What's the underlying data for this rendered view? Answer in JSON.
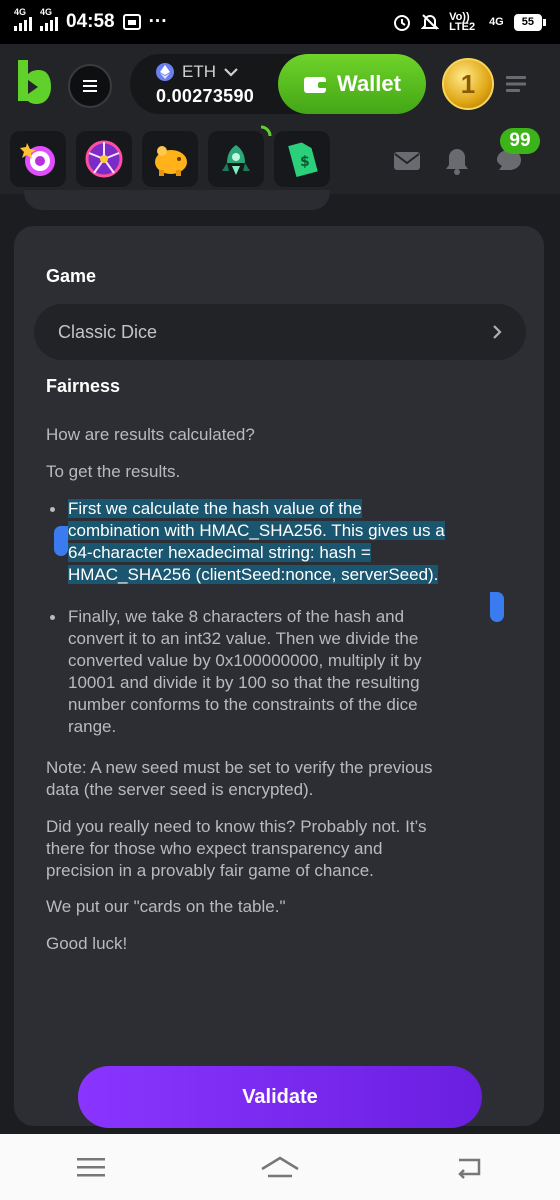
{
  "status_bar": {
    "time": "04:58",
    "net1": "4G",
    "net2": "4G",
    "volte": "Vo)) LTE2",
    "net3": "4G",
    "battery": "55"
  },
  "header": {
    "currency": "ETH",
    "balance": "0.00273590",
    "wallet_label": "Wallet"
  },
  "notifications": {
    "chat_count": "99"
  },
  "content": {
    "game_heading": "Game",
    "game_value": "Classic Dice",
    "fairness_heading": "Fairness",
    "q1": "How are results calculated?",
    "q2": "To get the results.",
    "bullet1_lines": [
      "First we calculate the hash value of the",
      "combination with HMAC_SHA256. This gives us a",
      "64-character hexadecimal string: hash =",
      "HMAC_SHA256 (clientSeed:nonce, serverSeed)."
    ],
    "bullet2_lines": [
      "Finally, we take 8 characters of the hash and",
      "convert it to an int32 value. Then we divide the",
      "converted value by 0x100000000, multiply it by",
      "10001 and divide it by 100 so that the resulting",
      "number conforms to the constraints of the dice",
      "range."
    ],
    "note_lines": [
      "Note: A new seed must be set to verify the previous",
      "data (the server seed is encrypted)."
    ],
    "did_lines": [
      "Did you really need to know this? Probably not. It’s",
      "there for those who expect transparency and",
      "precision in a provably fair game of chance."
    ],
    "cards": "We put our \"cards on the table.\"",
    "luck": "Good luck!"
  },
  "validate_label": "Validate",
  "colors": {
    "accent_green": "#4caf1f",
    "validate_purple": "#7b2cf5",
    "highlight": "#1a566f"
  }
}
